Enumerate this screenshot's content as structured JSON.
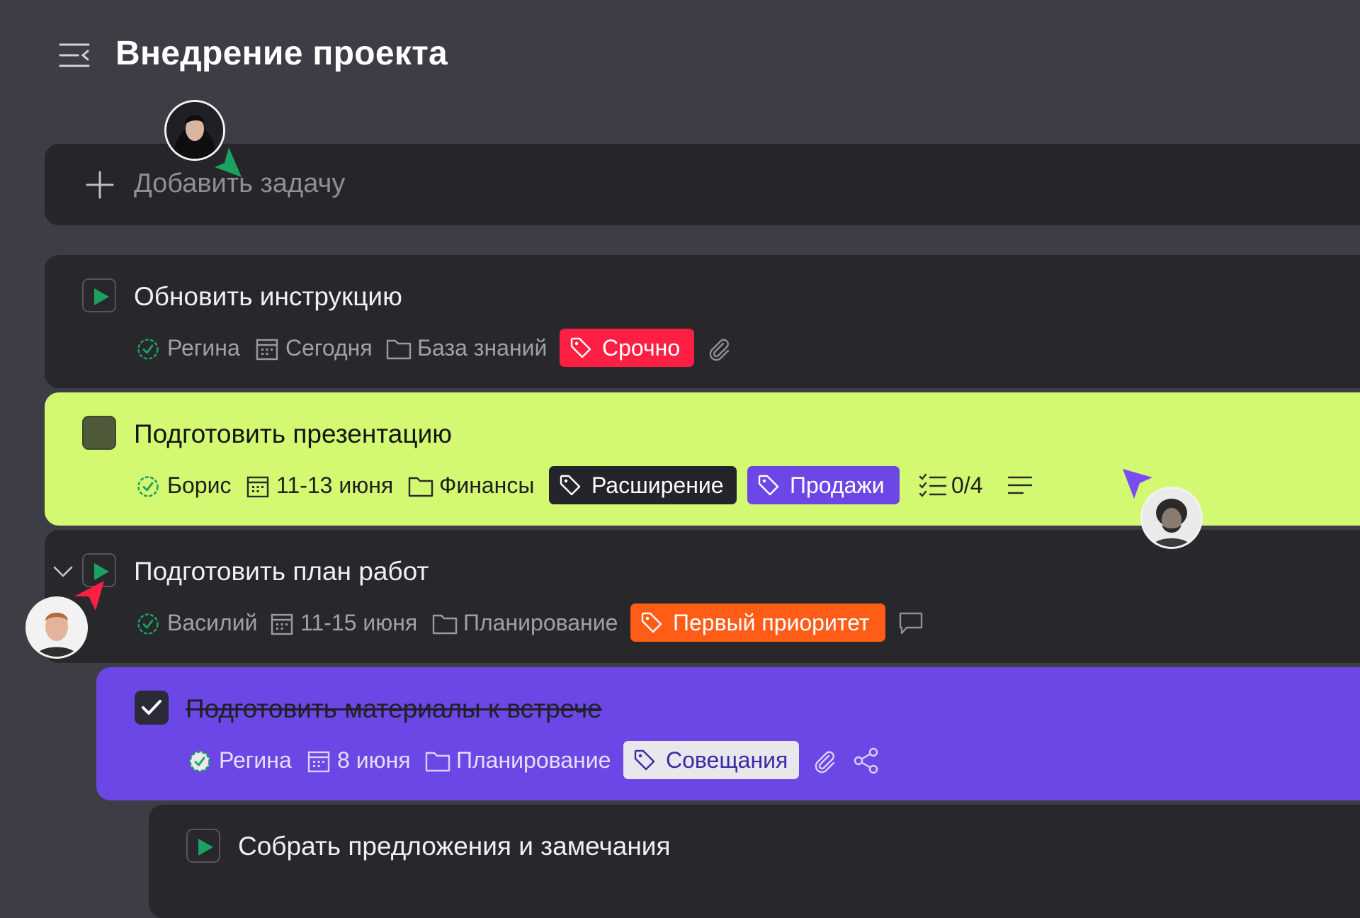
{
  "header": {
    "title": "Внедрение проекта",
    "menu_icon": "collapse-menu-icon"
  },
  "add_task": {
    "label": "Добавить задачу",
    "icon": "plus-icon"
  },
  "tasks": [
    {
      "title": "Обновить инструкцию",
      "state": "in-progress",
      "assignee": "Регина",
      "date": "Сегодня",
      "project": "База знаний",
      "tags": [
        {
          "label": "Срочно",
          "color": "#ff1f43"
        }
      ],
      "extras": [
        "paperclip-icon"
      ]
    },
    {
      "title": "Подготовить презентацию",
      "state": "todo",
      "background": "#d3f871",
      "assignee": "Борис",
      "date": "11-13 июня",
      "project": "Финансы",
      "tags": [
        {
          "label": "Расширение",
          "color": "#24242a"
        },
        {
          "label": "Продажи",
          "color": "#6c47e5"
        }
      ],
      "checklist": "0/4",
      "extras": [
        "checklist-icon",
        "description-icon"
      ]
    },
    {
      "title": "Подготовить план работ",
      "state": "in-progress",
      "expanded": true,
      "assignee": "Василий",
      "date": "11-15 июня",
      "project": "Планирование",
      "tags": [
        {
          "label": "Первый приоритет",
          "color": "#ff5d17"
        }
      ],
      "extras": [
        "comment-icon"
      ],
      "subtasks": [
        {
          "title": "Подготовить материалы к встрече",
          "state": "done",
          "background": "#6c47e5",
          "assignee": "Регина",
          "date": "8 июня",
          "project": "Планирование",
          "tags": [
            {
              "label": "Совещания",
              "color": "#e7e7ec"
            }
          ],
          "extras": [
            "paperclip-icon",
            "share-icon"
          ]
        },
        {
          "title": "Собрать предложения и замечания",
          "state": "in-progress"
        }
      ]
    }
  ],
  "cursors": [
    {
      "color": "#1ba160"
    },
    {
      "color": "#7a4cf2"
    },
    {
      "color": "#ff1f43"
    }
  ]
}
